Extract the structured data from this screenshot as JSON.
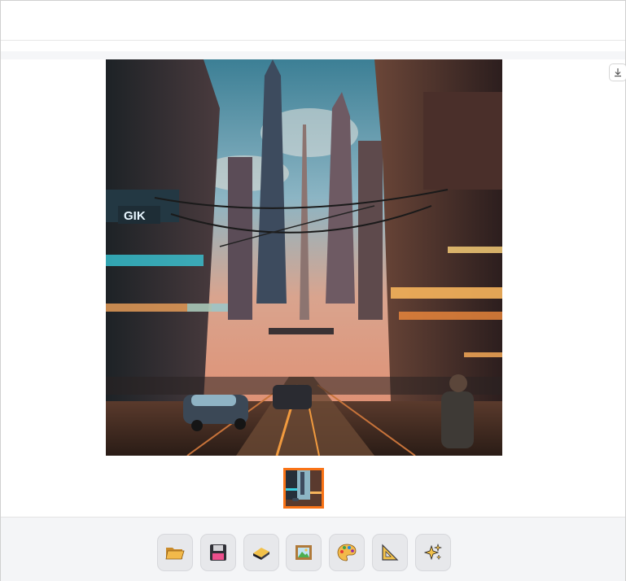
{
  "image": {
    "sign_text": "GIK"
  },
  "toolbar": {
    "tools": [
      {
        "icon": "folder-icon"
      },
      {
        "icon": "floppy-disk-icon"
      },
      {
        "icon": "eraser-icon"
      },
      {
        "icon": "framed-picture-icon"
      },
      {
        "icon": "palette-icon"
      },
      {
        "icon": "triangle-ruler-icon"
      },
      {
        "icon": "sparkles-icon"
      }
    ]
  },
  "colors": {
    "accent": "#f97316",
    "toolbar_bg": "#f4f5f7",
    "tool_bg": "#e7e8eb"
  }
}
